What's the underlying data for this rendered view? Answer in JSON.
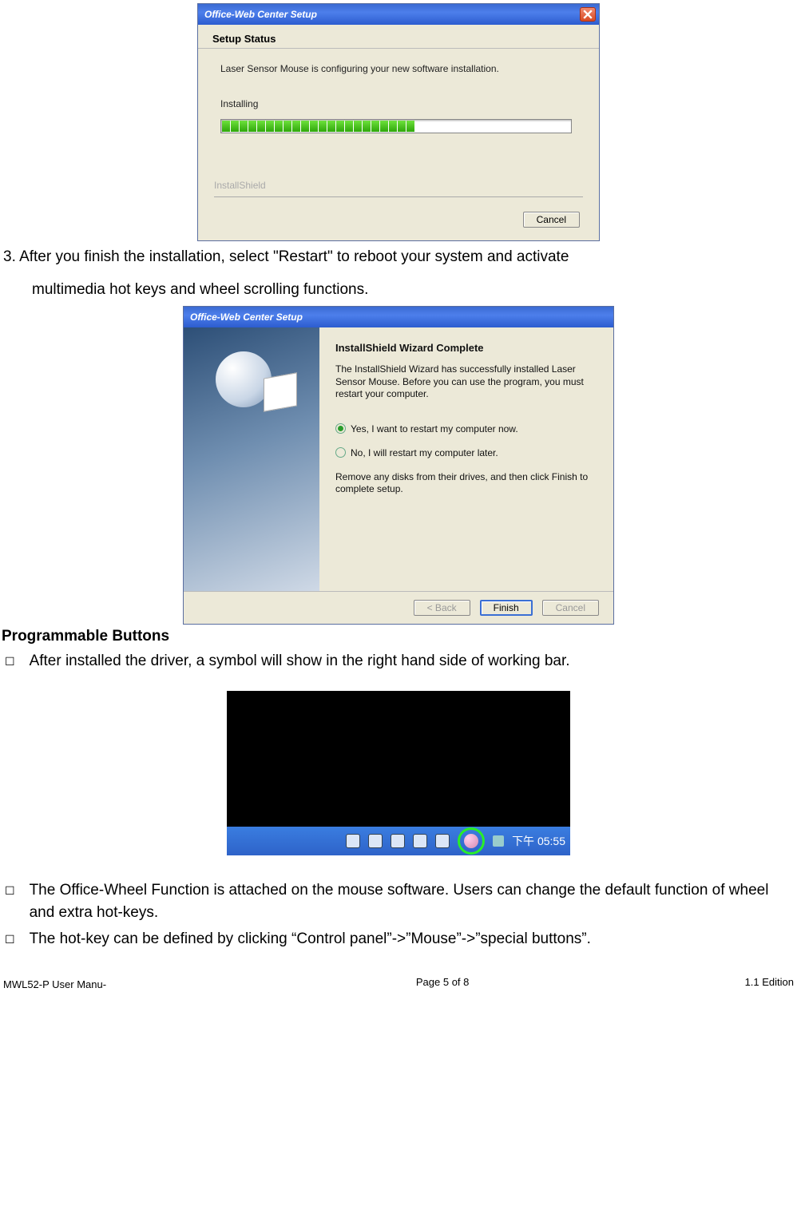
{
  "dlg1": {
    "title": "Office-Web Center Setup",
    "heading": "Setup Status",
    "line1": "Laser Sensor Mouse is configuring your new software installation.",
    "installing_label": "Installing",
    "installshield_label": "InstallShield",
    "cancel_label": "Cancel"
  },
  "step3_text_a": "3. After you finish the installation, select \"Restart\" to reboot your system and activate",
  "step3_text_b": "multimedia hot keys and wheel scrolling functions.",
  "dlg2": {
    "title": "Office-Web Center Setup",
    "heading": "InstallShield Wizard Complete",
    "para": "The InstallShield Wizard has successfully installed Laser Sensor Mouse.  Before you can use the program, you must restart your computer.",
    "radio_yes": "Yes, I want to restart my computer now.",
    "radio_no": "No, I will restart my computer later.",
    "para2": "Remove any disks from their drives, and then click Finish to complete setup.",
    "back_label": "< Back",
    "finish_label": "Finish",
    "cancel_label": "Cancel"
  },
  "section_heading": "Programmable Buttons",
  "bullet1": "After installed the driver, a symbol will show in the right hand side of working bar.",
  "taskbar": {
    "clock": "下午 05:55"
  },
  "bullet2": "The Office-Wheel Function is attached on the mouse software. Users can change the default function of wheel and extra hot-keys.",
  "bullet3": "The hot-key can be defined by clicking “Control panel”->”Mouse”->”special buttons”.",
  "footer": {
    "left": "MWL52-P User Manu-  　　　",
    "center": "Page 5 of 8",
    "right": "1.1 Edition"
  }
}
